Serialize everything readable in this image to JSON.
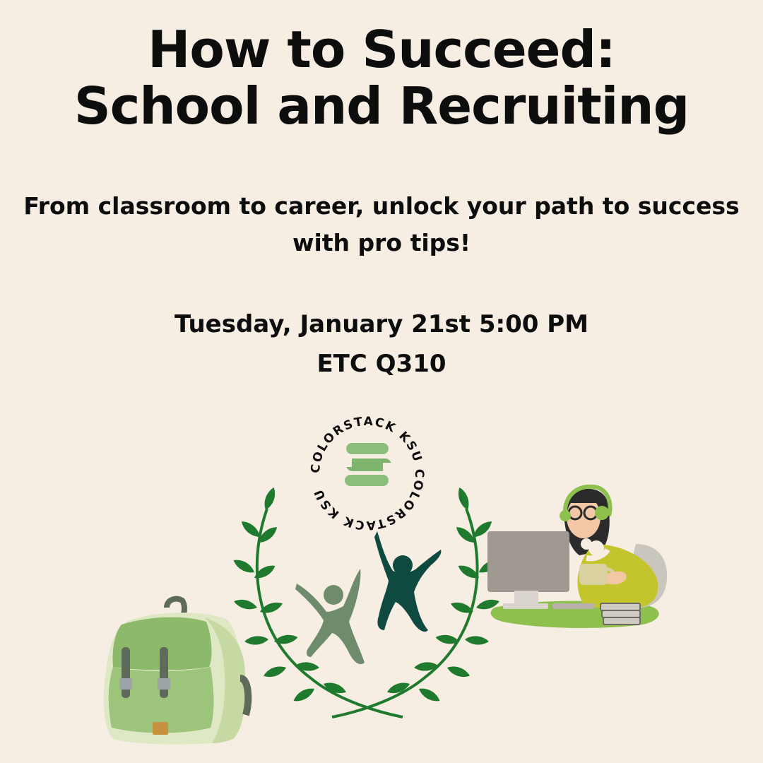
{
  "title": {
    "line1": "How to Succeed:",
    "line2": "School and Recruiting"
  },
  "subtitle": {
    "line1": "From classroom to career, unlock your path to success",
    "line2": "with pro tips!"
  },
  "event": {
    "datetime": "Tuesday, January 21st 5:00 PM",
    "location": "ETC Q310"
  },
  "logo": {
    "ring_text": "COLORSTACK KSU  COLORSTACK KSU  "
  },
  "colors": {
    "background": "#f6ede3",
    "text": "#0d0d0d",
    "leaf_green": "#1f7a2e",
    "logo_green": "#8cbf7e",
    "figure_dark": "#0f4a40",
    "figure_light": "#6e8b6c"
  }
}
